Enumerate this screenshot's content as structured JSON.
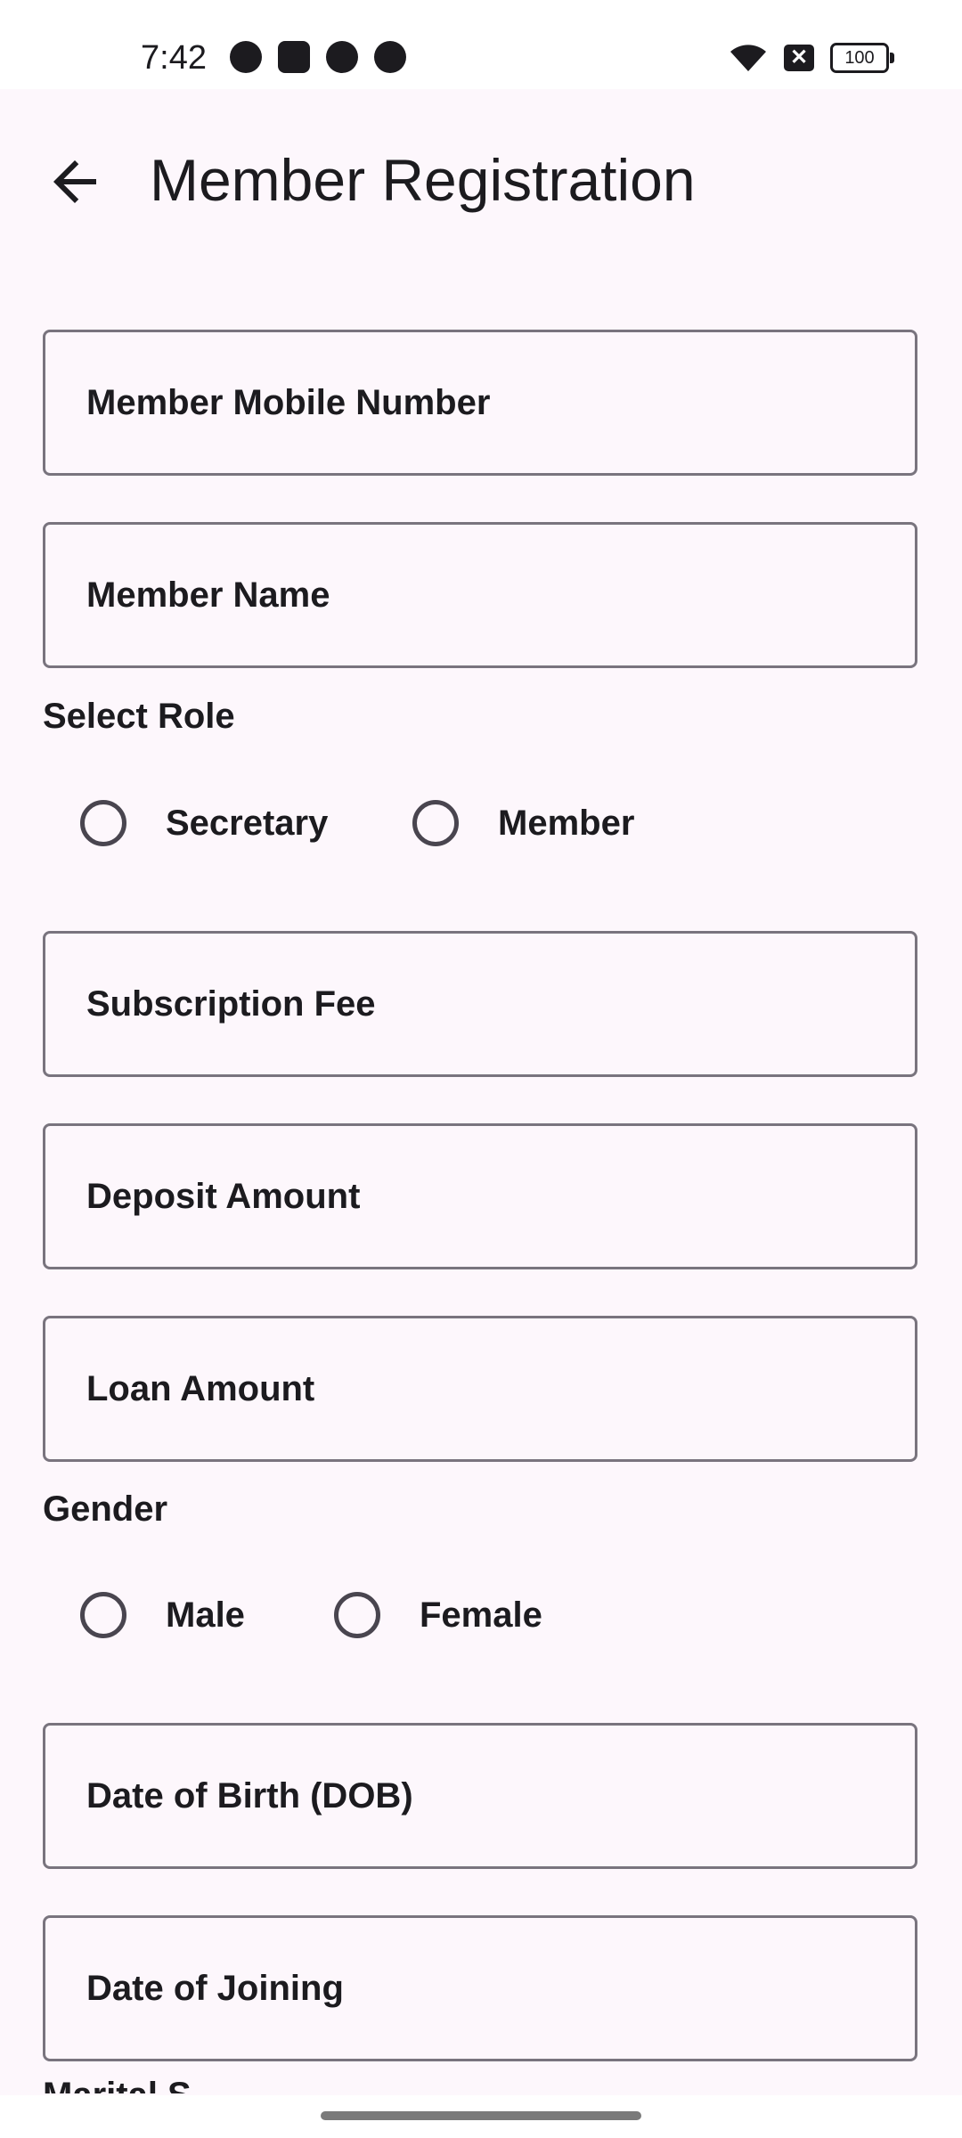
{
  "status_bar": {
    "time": "7:42",
    "battery": "100",
    "left_icons": [
      "transit-icon",
      "app-icon",
      "reddit-icon",
      "club-badge-icon"
    ],
    "right_icons": [
      "wifi-icon",
      "close-box-icon",
      "battery-icon"
    ]
  },
  "app_bar": {
    "title": "Member Registration",
    "back_icon": "arrow-back-icon"
  },
  "form": {
    "mobile_label": "Member Mobile Number",
    "name_label": "Member Name",
    "role": {
      "label": "Select Role",
      "options": [
        "Secretary",
        "Member"
      ]
    },
    "subscription_label": "Subscription Fee",
    "deposit_label": "Deposit Amount",
    "loan_label": "Loan Amount",
    "gender": {
      "label": "Gender",
      "options": [
        "Male",
        "Female"
      ]
    },
    "dob_label": "Date of Birth (DOB)",
    "joining_label": "Date of Joining",
    "next_partial_label": "Marital S..."
  },
  "colors": {
    "background": "#fdf7fc",
    "outline": "#79747e",
    "text": "#1c1b1f"
  }
}
